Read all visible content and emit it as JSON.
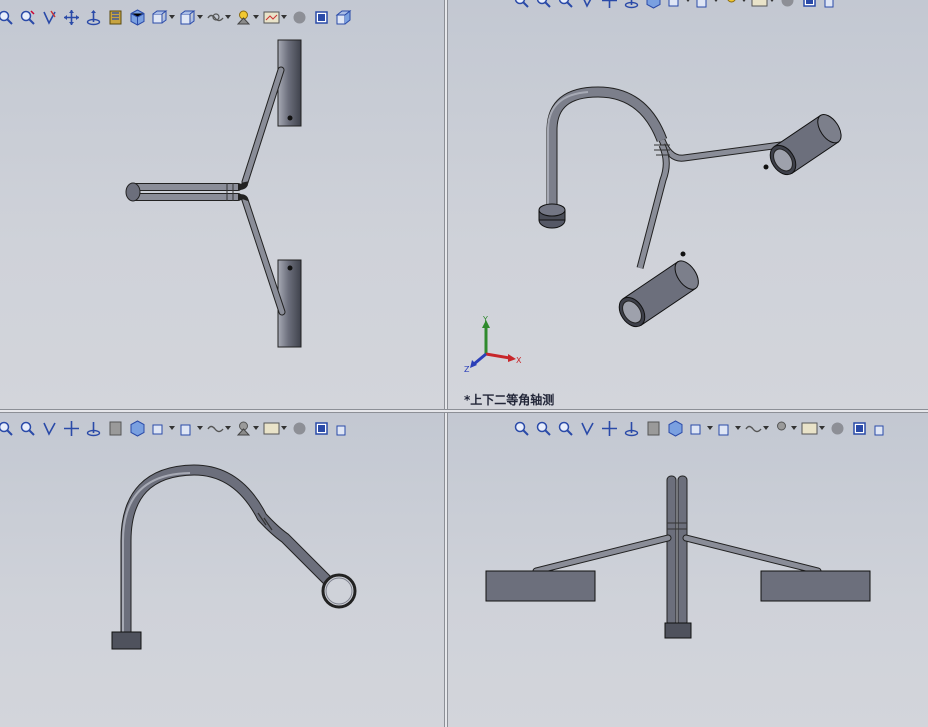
{
  "viewports": {
    "top_left": {
      "name": "top-view"
    },
    "top_right": {
      "name": "isometric-view",
      "view_label": "*上下二等角轴测"
    },
    "bottom_left": {
      "name": "front-view"
    },
    "bottom_right": {
      "name": "side-view"
    }
  },
  "triad": {
    "x_label": "X",
    "y_label": "Y",
    "z_label": "Z"
  },
  "toolbar_icons": [
    "zoom-to-fit-icon",
    "zoom-to-area-icon",
    "previous-view-icon",
    "section-view-icon",
    "pan-icon",
    "rotate-icon",
    "view-orientation-icon",
    "display-style-icon",
    "hide-show-items-icon",
    "edit-appearance-icon",
    "apply-scene-icon",
    "view-settings-icon",
    "realview-icon",
    "shadows-icon",
    "perspective-icon"
  ],
  "colors": {
    "background": "#c9ccd4",
    "part_fill": "#6c6f7c",
    "part_dark": "#3f424c",
    "part_light": "#a7aab5",
    "axis_x": "#c8262a",
    "axis_y": "#2f8a2d",
    "axis_z": "#2b3fb8"
  }
}
